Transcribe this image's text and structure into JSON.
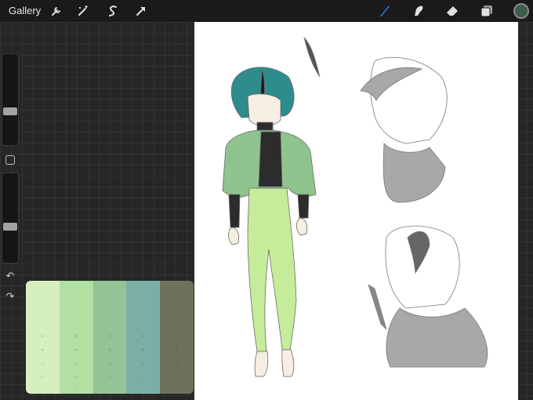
{
  "topbar": {
    "gallery_label": "Gallery",
    "left_tools": [
      "wrench-icon",
      "magic-wand-icon",
      "selection-icon",
      "transform-arrow-icon"
    ],
    "right_tools": [
      "brush-icon",
      "smudge-icon",
      "eraser-icon",
      "layers-icon"
    ],
    "active_tool": "brush-icon",
    "current_color": "#3c5f49"
  },
  "sidebar": {
    "brush_size_level": 0.3,
    "opacity_level": 0.3,
    "icons": [
      "modifier-square-icon",
      "undo-icon",
      "redo-icon"
    ]
  },
  "palette": {
    "colors": [
      "#d6efbf",
      "#b2dfa2",
      "#94c495",
      "#7bafa6",
      "#6c735a"
    ]
  },
  "colors": {
    "accent": "#2f7cf6",
    "canvas": "#ffffff",
    "hair": "#2f8c8c",
    "jacket": "#8fc48f",
    "pants": "#c5ec9a",
    "shirt": "#2c2c2c",
    "sketch": "#9c9c9c"
  }
}
